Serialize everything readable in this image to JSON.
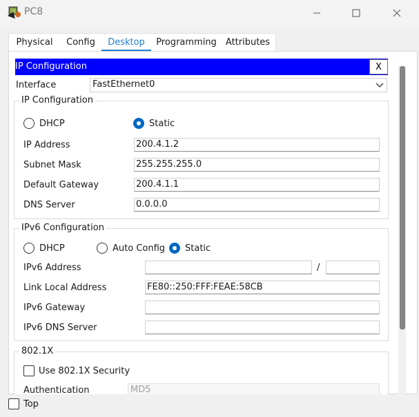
{
  "window": {
    "title": "PC8",
    "controls": [
      "minimize",
      "maximize",
      "close"
    ]
  },
  "tabs": [
    {
      "label": "Physical",
      "active": false
    },
    {
      "label": "Config",
      "active": false
    },
    {
      "label": "Desktop",
      "active": true
    },
    {
      "label": "Programming",
      "active": false
    },
    {
      "label": "Attributes",
      "active": false
    }
  ],
  "ip_config_window": {
    "title": "IP Configuration",
    "close_label": "X",
    "interface_label": "Interface",
    "interface_value": "FastEthernet0"
  },
  "ipv4": {
    "group_title": "IP Configuration",
    "dhcp_label": "DHCP",
    "static_label": "Static",
    "mode": "Static",
    "ip_address_label": "IP Address",
    "ip_address": "200.4.1.2",
    "subnet_mask_label": "Subnet Mask",
    "subnet_mask": "255.255.255.0",
    "default_gateway_label": "Default Gateway",
    "default_gateway": "200.4.1.1",
    "dns_server_label": "DNS Server",
    "dns_server": "0.0.0.0"
  },
  "ipv6": {
    "group_title": "IPv6 Configuration",
    "dhcp_label": "DHCP",
    "auto_config_label": "Auto Config",
    "static_label": "Static",
    "mode": "Static",
    "ipv6_address_label": "IPv6 Address",
    "ipv6_address": "",
    "prefix_separator": "/",
    "prefix_length": "",
    "link_local_label": "Link Local Address",
    "link_local_address": "FE80::250:FFF:FEAE:58CB",
    "ipv6_gateway_label": "IPv6 Gateway",
    "ipv6_gateway": "",
    "ipv6_dns_label": "IPv6 DNS Server",
    "ipv6_dns": ""
  },
  "dot1x": {
    "group_title": "802.1X",
    "use_security_label": "Use 802.1X Security",
    "use_security": false,
    "authentication_label": "Authentication",
    "authentication_value": "MD5"
  },
  "footer": {
    "top_label": "Top",
    "top_checked": false
  },
  "colors": {
    "header_blue": "#0000ff",
    "tab_accent": "#1e7fd4",
    "radio_selected": "#0067c0"
  }
}
